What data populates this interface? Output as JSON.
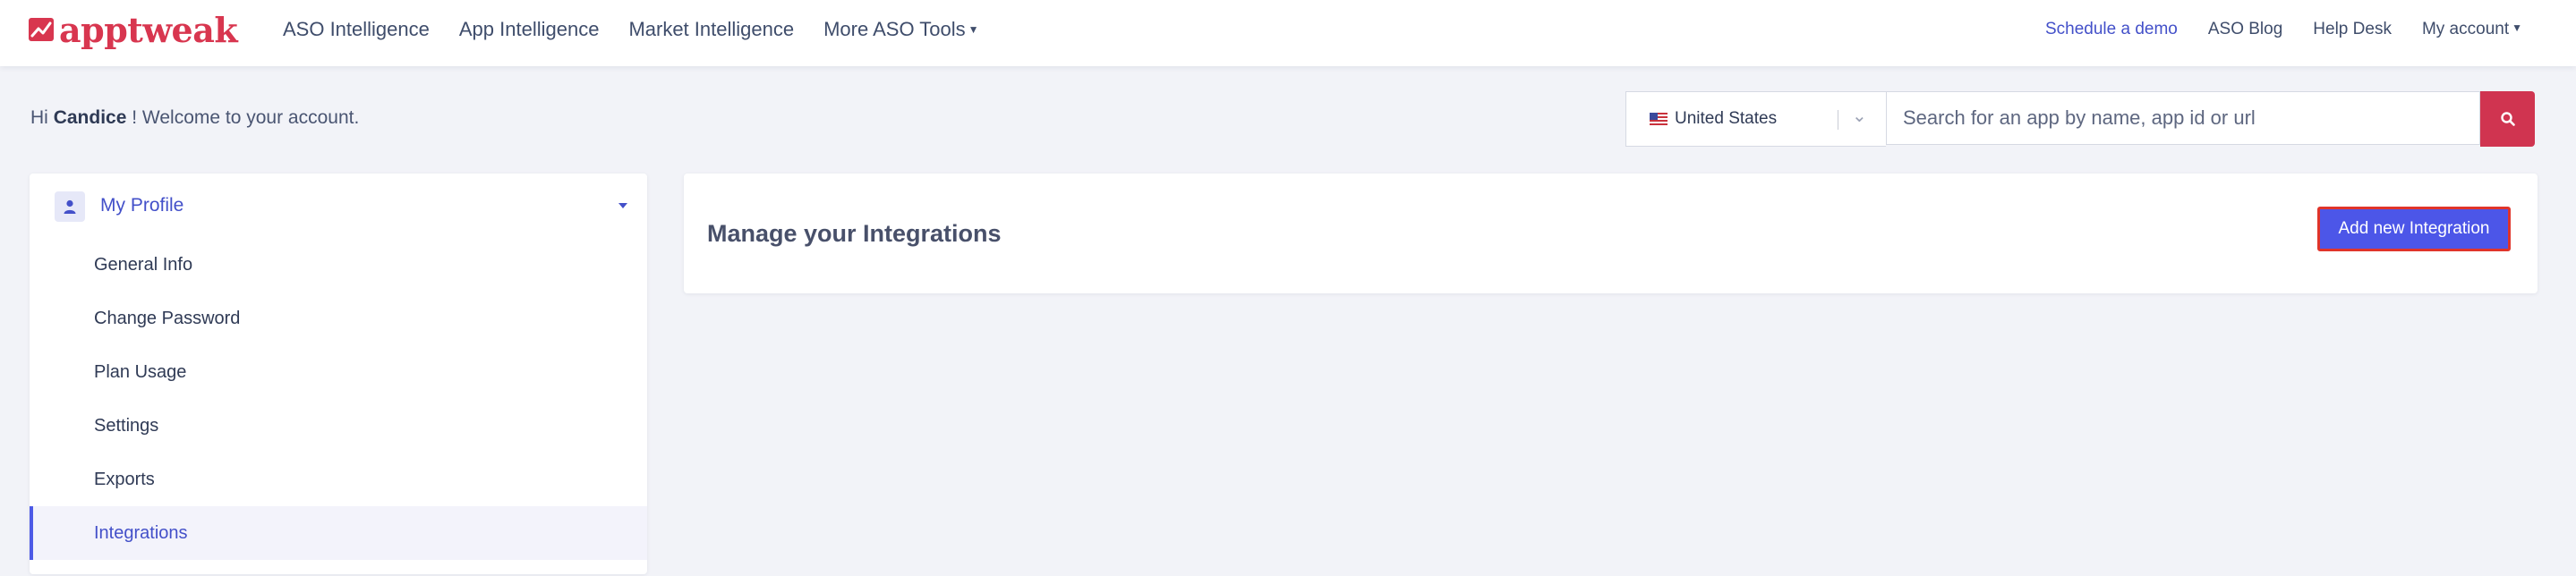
{
  "brand": {
    "name": "apptweak",
    "color": "#d8364f"
  },
  "nav": {
    "left": [
      "ASO Intelligence",
      "App Intelligence",
      "Market Intelligence",
      "More ASO Tools"
    ],
    "right": [
      "Schedule a demo",
      "ASO Blog",
      "Help Desk",
      "My account"
    ]
  },
  "greeting": {
    "prefix": "Hi",
    "name": "Candice",
    "suffix": "! Welcome to your account."
  },
  "search": {
    "country": "United States",
    "placeholder": "Search for an app by name, app id or url",
    "button_icon": "search-icon"
  },
  "sidebar": {
    "header": {
      "label": "My Profile",
      "icon": "user-icon"
    },
    "items": [
      {
        "label": "General Info"
      },
      {
        "label": "Change Password"
      },
      {
        "label": "Plan Usage"
      },
      {
        "label": "Settings"
      },
      {
        "label": "Exports"
      },
      {
        "label": "Integrations",
        "active": true
      }
    ]
  },
  "main": {
    "title": "Manage your Integrations",
    "add_button": "Add new Integration"
  },
  "colors": {
    "accent": "#4c56e8",
    "brand_red": "#d03450",
    "background": "#f2f3f8"
  }
}
